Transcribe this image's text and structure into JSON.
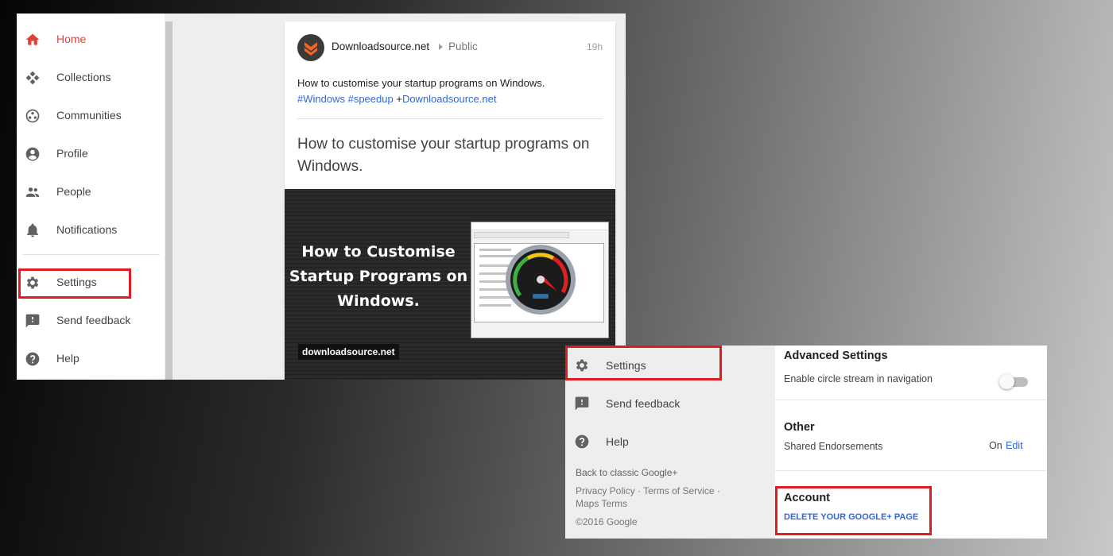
{
  "colors": {
    "active": "#db4437",
    "highlight": "#e11b22",
    "link": "#3367d6"
  },
  "sidebar": {
    "items": [
      {
        "label": "Home",
        "icon": "home-icon",
        "active": true
      },
      {
        "label": "Collections",
        "icon": "collections-icon"
      },
      {
        "label": "Communities",
        "icon": "communities-icon"
      },
      {
        "label": "Profile",
        "icon": "profile-icon"
      },
      {
        "label": "People",
        "icon": "people-icon"
      },
      {
        "label": "Notifications",
        "icon": "bell-icon"
      },
      {
        "label": "Settings",
        "icon": "gear-icon"
      },
      {
        "label": "Send feedback",
        "icon": "feedback-icon"
      },
      {
        "label": "Help",
        "icon": "help-icon"
      }
    ]
  },
  "post": {
    "author": "Downloadsource.net",
    "visibility": "Public",
    "time": "19h",
    "text": "How to customise your startup programs on Windows.",
    "tags": [
      "#Windows",
      "#speedup"
    ],
    "mention_prefix": "+",
    "mention": "Downloadsource.net",
    "headline": "How to customise your startup programs on Windows.",
    "image_title": "How to Customise Startup Programs on Windows.",
    "image_site": "downloadsource.net"
  },
  "settings_nav": {
    "items": [
      {
        "label": "Settings",
        "icon": "gear-icon"
      },
      {
        "label": "Send feedback",
        "icon": "feedback-icon"
      },
      {
        "label": "Help",
        "icon": "help-icon"
      }
    ],
    "classic_link": "Back to classic Google+",
    "policy_links": "Privacy Policy · Terms of Service ·",
    "maps_terms": "Maps Terms",
    "copyright": "©2016 Google"
  },
  "settings": {
    "advanced_title": "Advanced Settings",
    "circle_stream_label": "Enable circle stream in navigation",
    "circle_stream_on": false,
    "other_title": "Other",
    "endorsements_label": "Shared Endorsements",
    "endorsements_state": "On",
    "edit_label": "Edit",
    "account_title": "Account",
    "delete_label": "DELETE YOUR GOOGLE+ PAGE"
  }
}
